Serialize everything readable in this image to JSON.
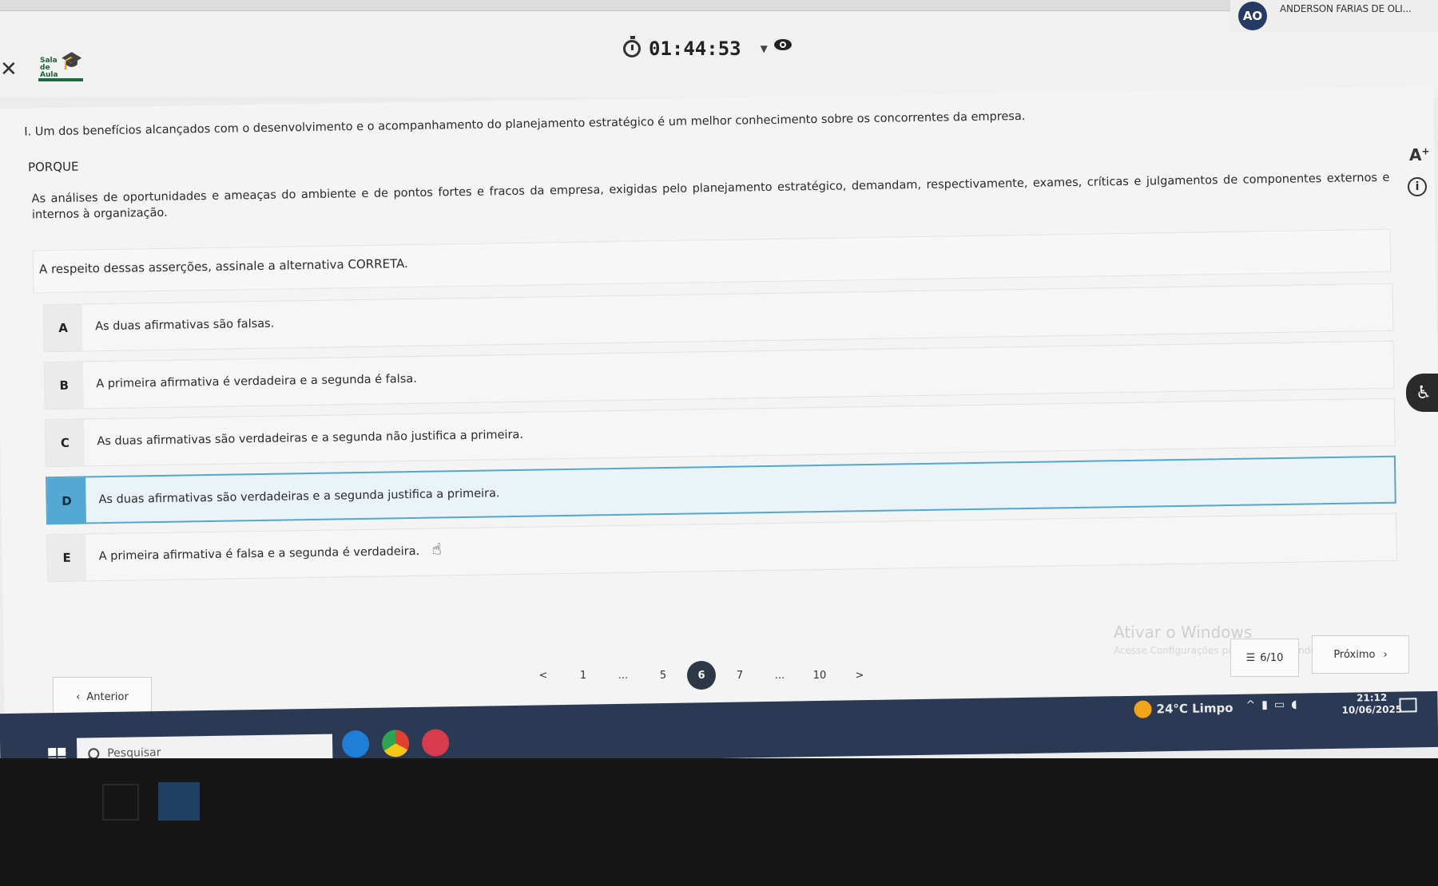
{
  "header": {
    "logo_text": "Sala de Aula",
    "timer": "01:44:53",
    "user_initials": "AO",
    "user_name": "ANDERSON FARIAS DE OLI..."
  },
  "question": {
    "statement_1": "I. Um dos benefícios alcançados com o desenvolvimento e o acompanhamento do planejamento estratégico é um melhor conhecimento sobre os concorrentes da empresa.",
    "connector": "PORQUE",
    "statement_2": "As análises de oportunidades e ameaças do ambiente e de pontos fortes e fracos da empresa, exigidas pelo planejamento estratégico, demandam, respectivamente, exames, críticas e julgamentos de componentes externos e internos à organização.",
    "prompt": "A respeito dessas asserções, assinale a alternativa CORRETA.",
    "options": [
      {
        "letter": "A",
        "text": "As duas afirmativas são falsas."
      },
      {
        "letter": "B",
        "text": "A primeira afirmativa é verdadeira e a segunda é falsa."
      },
      {
        "letter": "C",
        "text": "As duas afirmativas são verdadeiras e a segunda não justifica a primeira."
      },
      {
        "letter": "D",
        "text": "As duas afirmativas são verdadeiras e a segunda justifica a primeira."
      },
      {
        "letter": "E",
        "text": "A primeira afirmativa é falsa e a segunda é verdadeira."
      }
    ],
    "selected": "D"
  },
  "side_tools": {
    "font_size_label": "A",
    "font_size_sup": "+",
    "info_symbol": "i"
  },
  "navigation": {
    "prev_label": "Anterior",
    "next_label": "Próximo",
    "progress": "6/10",
    "pages": [
      "<",
      "1",
      "...",
      "5",
      "6",
      "7",
      "...",
      "10",
      ">"
    ],
    "current_page": "6"
  },
  "windows_watermark": {
    "title": "Ativar o Windows",
    "subtitle": "Acesse Configurações para ativar o Windows."
  },
  "taskbar": {
    "search_placeholder": "Pesquisar",
    "weather": "24°C Limpo",
    "time": "21:12",
    "date": "10/06/2025"
  },
  "colors": {
    "selected_accent": "#54a9d3",
    "active_page": "#2d3746",
    "avatar_bg": "#263b64",
    "taskbar_bg": "#2a3a55"
  },
  "icons": [
    "close-icon",
    "stopwatch-icon",
    "chevron-down-icon",
    "eye-icon",
    "font-size-icon",
    "info-icon",
    "accessibility-icon",
    "pointer-hand-icon",
    "list-icon",
    "windows-icon",
    "search-icon",
    "weather-sun-icon"
  ]
}
